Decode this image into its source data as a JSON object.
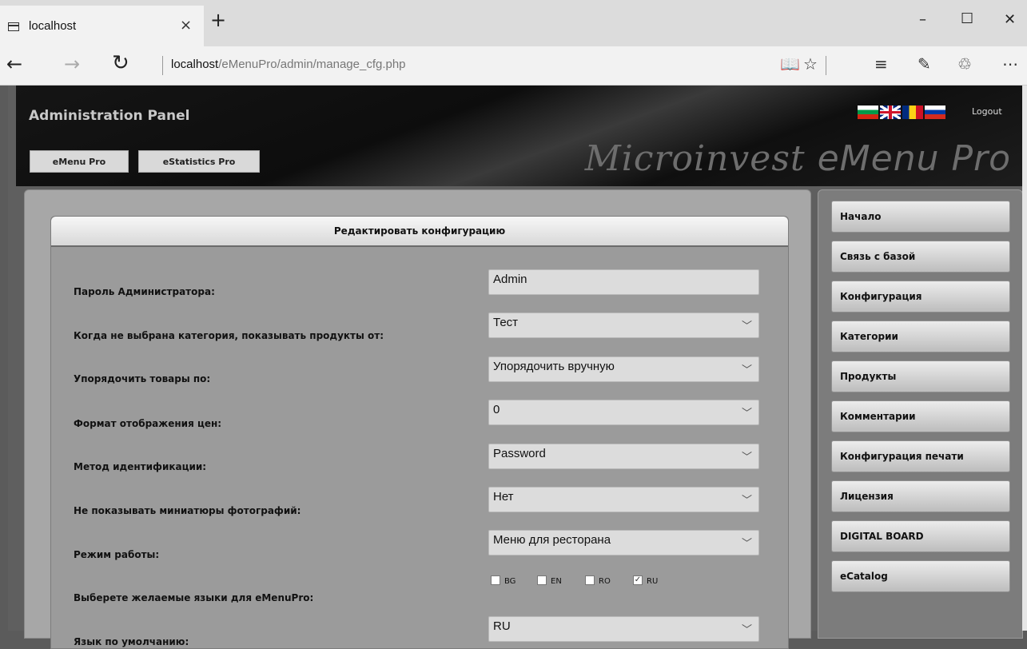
{
  "browser": {
    "tab_title": "localhost",
    "tab_close": "×",
    "new_tab": "+",
    "url_host": "localhost",
    "url_path": "/eMenuPro/admin/manage_cfg.php",
    "icons": [
      "back-icon",
      "forward-icon",
      "refresh-icon",
      "reading-view-icon",
      "favorite-star-icon",
      "hub-icon",
      "web-note-icon",
      "share-icon",
      "more-icon"
    ]
  },
  "header": {
    "title": "Administration Panel",
    "buttons": [
      "eMenu Pro",
      "eStatistics Pro"
    ],
    "brand_part1": "Microinvest ",
    "brand_part2": "eMenu Pro",
    "logout": "Logout",
    "flags": [
      "BG",
      "EN",
      "RO",
      "RU"
    ]
  },
  "form": {
    "title": "Редактировать конфигурацию",
    "rows": [
      {
        "label": "Пароль Администратора:",
        "value": "Admin",
        "type": "text"
      },
      {
        "label": "Когда не выбрана категория, показывать продукты от:",
        "value": "Тест",
        "type": "select"
      },
      {
        "label": "Упорядочить товары по:",
        "value": "Упорядочить вручную",
        "type": "select"
      },
      {
        "label": "Формат отображения цен:",
        "value": "0",
        "type": "select"
      },
      {
        "label": "Метод идентификации:",
        "value": "Password",
        "type": "select"
      },
      {
        "label": "Не показывать миниатюры фотографий:",
        "value": "Нет",
        "type": "select"
      },
      {
        "label": "Режим работы:",
        "value": "Меню для ресторана",
        "type": "select"
      },
      {
        "label": "Выберете желаемые языки для eMenuPro:",
        "type": "checkboxes"
      },
      {
        "label": "Язык по умолчанию:",
        "value": "RU",
        "type": "select"
      }
    ],
    "languages": [
      {
        "code": "BG",
        "checked": false
      },
      {
        "code": "EN",
        "checked": false
      },
      {
        "code": "RO",
        "checked": false
      },
      {
        "code": "RU",
        "checked": true
      }
    ]
  },
  "sidebar": {
    "items": [
      "Начало",
      "Связь с базой",
      "Конфигурация",
      "Категории",
      "Продукты",
      "Комментарии",
      "Конфигурация печати",
      "Лицензия",
      "DIGITAL BOARD",
      "eCatalog"
    ]
  }
}
